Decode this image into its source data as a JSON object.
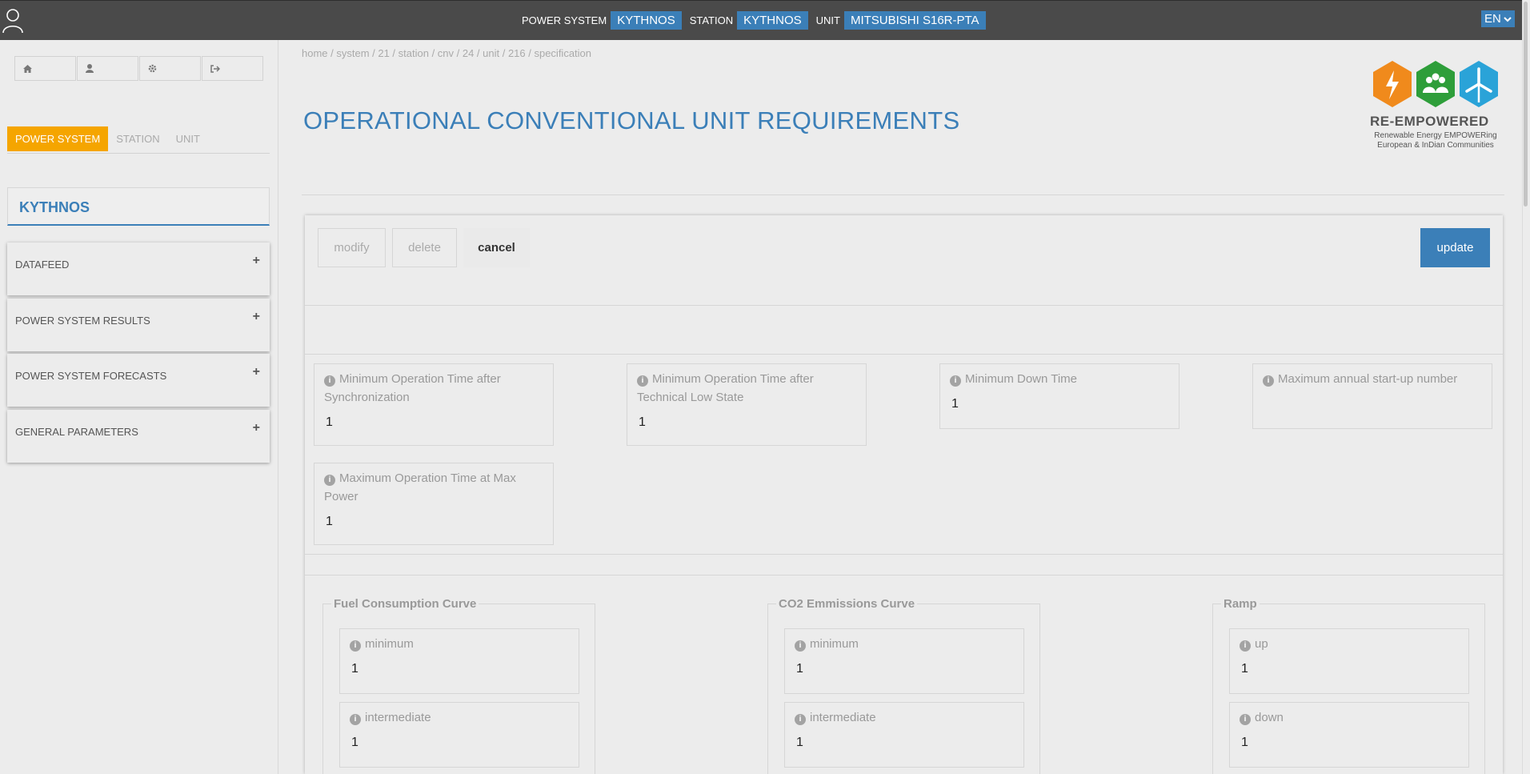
{
  "topbar": {
    "power_system_label": "POWER SYSTEM",
    "power_system_value": "KYTHNOS",
    "station_label": "STATION",
    "station_value": "KYTHNOS",
    "unit_label": "UNIT",
    "unit_value": "MITSUBISHI S16R-PTA",
    "language": "EN"
  },
  "sidebar": {
    "icon_buttons": [
      "home-icon",
      "user-icon",
      "cog-icon",
      "sign-out-icon"
    ],
    "tabs": [
      {
        "label": "POWER SYSTEM",
        "active": true
      },
      {
        "label": "STATION",
        "active": false
      },
      {
        "label": "UNIT",
        "active": false
      }
    ],
    "system_name": "KYTHNOS",
    "panels": [
      {
        "label": "DATAFEED"
      },
      {
        "label": "POWER SYSTEM RESULTS"
      },
      {
        "label": "POWER SYSTEM FORECASTS"
      },
      {
        "label": "GENERAL PARAMETERS"
      }
    ]
  },
  "breadcrumb": "home / system / 21 / station / cnv / 24 / unit / 216 / specification",
  "page_title": "OPERATIONAL CONVENTIONAL UNIT REQUIREMENTS",
  "logo": {
    "name": "RE-EMPOWERED",
    "tagline_1": "Renewable Energy EMPOWERing",
    "tagline_2": "European & InDian Communities",
    "colors": [
      "#f08a1c",
      "#2e9e3a",
      "#2aa3d8"
    ]
  },
  "actions": {
    "modify": "modify",
    "delete": "delete",
    "cancel": "cancel",
    "update": "update"
  },
  "fields": [
    {
      "label": "Minimum Operation Time after Synchronization",
      "value": "1"
    },
    {
      "label": "Minimum Operation Time after Technical Low State",
      "value": "1"
    },
    {
      "label": "Minimum Down Time",
      "value": "1"
    },
    {
      "label": "Maximum annual start-up number",
      "value": ""
    },
    {
      "label": "Maximum Operation Time at Max Power",
      "value": "1"
    }
  ],
  "groups": [
    {
      "legend": "Fuel Consumption Curve",
      "fields": [
        {
          "label": "minimum",
          "value": "1"
        },
        {
          "label": "intermediate",
          "value": "1"
        }
      ]
    },
    {
      "legend": "CO2 Emmissions Curve",
      "fields": [
        {
          "label": "minimum",
          "value": "1"
        },
        {
          "label": "intermediate",
          "value": "1"
        }
      ]
    },
    {
      "legend": "Ramp",
      "fields": [
        {
          "label": "up",
          "value": "1"
        },
        {
          "label": "down",
          "value": "1"
        }
      ]
    }
  ],
  "colors": {
    "accent": "#3b7fb8",
    "active_tab": "#f5a500",
    "topbar": "#4a4a4a"
  }
}
